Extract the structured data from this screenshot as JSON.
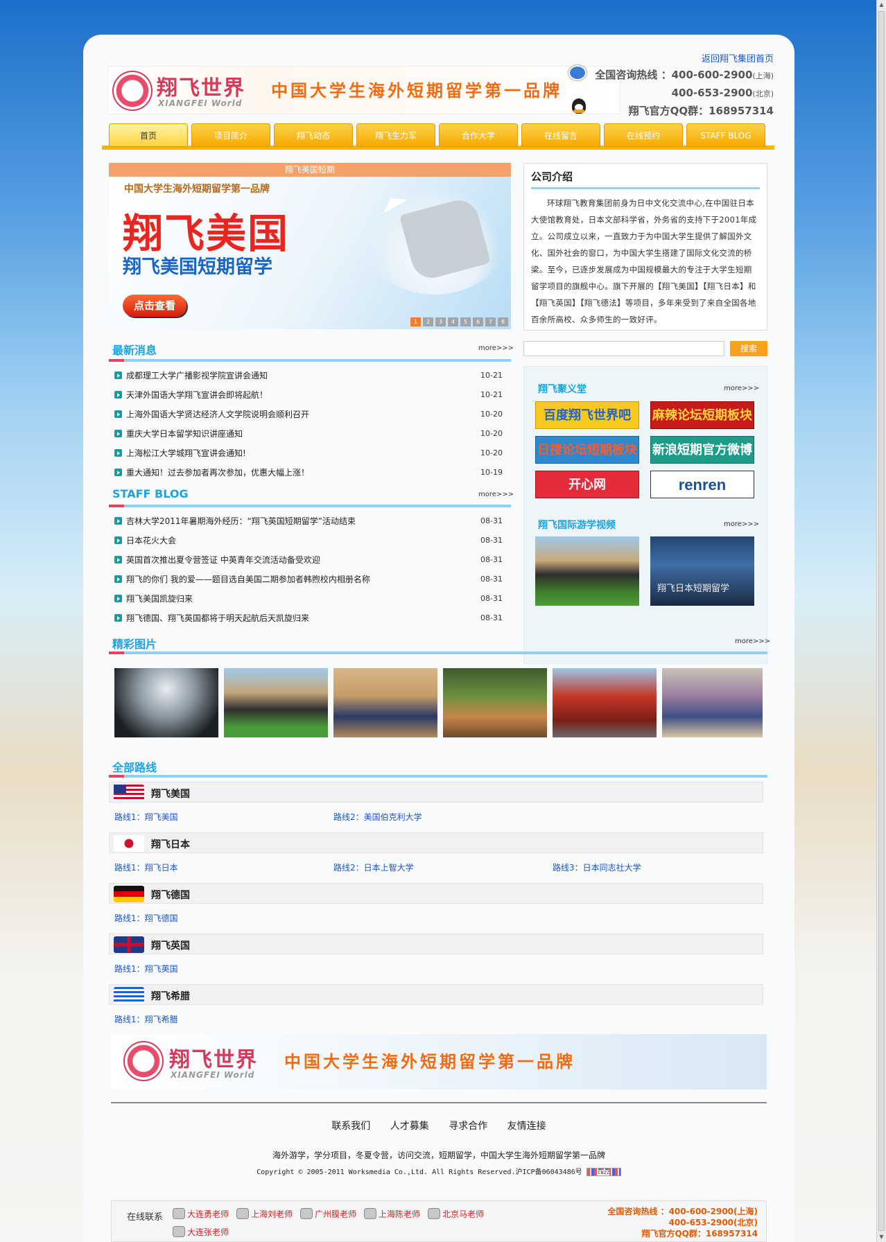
{
  "header": {
    "top_link": "返回翔飞集团首页",
    "logo_name": "翔飞世界",
    "logo_sub": "XIANGFEI World",
    "slogan": "中国大学生海外短期留学第一品牌",
    "hotline_label": "全国咨询热线 ：400-600-2900",
    "hotline1_city": "(上海)",
    "hotline2": "400-653-2900",
    "hotline2_city": "(北京)",
    "qq_group": "翔飞官方QQ群：168957314"
  },
  "nav": [
    "首页",
    "项目简介",
    "翔飞动态",
    "翔飞生力军",
    "合作大学",
    "在线留言",
    "在线预约",
    "STAFF BLOG"
  ],
  "banner": {
    "title": "翔飞美国短期",
    "tag": "中国大学生海外短期留学第一品牌",
    "big": "翔飞美国",
    "sub": "翔飞美国短期留学",
    "button": "点击查看",
    "pages": [
      "1",
      "2",
      "3",
      "4",
      "5",
      "6",
      "7",
      "8"
    ]
  },
  "intro": {
    "title": "公司介绍",
    "text": "环球翔飞教育集团前身为日中文化交流中心,在中国驻日本大使馆教育处，日本文部科学省，外务省的支持下于2001年成立。公司成立以来，一直致力于为中国大学生提供了解国外文化、国外社会的窗口，为中国大学生搭建了国际文化交流的桥梁。至今，已逐步发展成为中国规模最大的专注于大学生短期留学项目的旗舰中心。旗下开展的【翔飞美国】【翔飞日本】和【翔飞英国】【翔飞德法】等项目，多年来受到了来自全国各地百余所高校、众多师生的一致好评。"
  },
  "search": {
    "button": "搜索",
    "placeholder": ""
  },
  "more": "more>>>",
  "news": {
    "title": "最新消息",
    "items": [
      {
        "text": "成都理工大学广播影视学院宣讲会通知",
        "date": "10-21"
      },
      {
        "text": "天津外国语大学翔飞宣讲会即将起航！",
        "date": "10-21"
      },
      {
        "text": "上海外国语大学贤达经济人文学院说明会顺利召开",
        "date": "10-20"
      },
      {
        "text": "重庆大学日本留学知识讲座通知",
        "date": "10-20"
      },
      {
        "text": "上海松江大学城翔飞宣讲会通知!",
        "date": "10-20"
      },
      {
        "text": "重大通知！过去参加者再次参加，优惠大幅上涨！",
        "date": "10-19"
      }
    ]
  },
  "blog": {
    "title": "STAFF BLOG",
    "items": [
      {
        "text": "吉林大学2011年暑期海外经历：“翔飞英国短期留学”活动结束",
        "date": "08-31"
      },
      {
        "text": "日本花火大会",
        "date": "08-31"
      },
      {
        "text": "英国首次推出夏令营签证 中英青年交流活动备受欢迎",
        "date": "08-31"
      },
      {
        "text": "翔飞的你们 我的爱——题目选自美国二期参加者韩煦校内相册名称",
        "date": "08-31"
      },
      {
        "text": "翔飞美国凯旋归来",
        "date": "08-31"
      },
      {
        "text": "翔飞德国、翔飞英国都将于明天起航后天凯旋归来",
        "date": "08-31"
      }
    ]
  },
  "community": {
    "title": "翔飞聚义堂",
    "tiles": [
      "百度翔飞世界吧",
      "麻辣论坛短期板块",
      "日搜论坛短期板块",
      "新浪短期官方微博",
      "开心网",
      "renren"
    ]
  },
  "video": {
    "title": "翔飞国际游学视频",
    "caption2": "翔飞日本短期留学"
  },
  "photos": {
    "title": "精彩图片"
  },
  "routes": {
    "title": "全部路线",
    "groups": [
      {
        "name": "翔飞美国",
        "links": [
          "路线1：翔飞美国",
          "路线2：美国伯克利大学"
        ]
      },
      {
        "name": "翔飞日本",
        "links": [
          "路线1：翔飞日本",
          "路线2：日本上智大学",
          "路线3：日本同志社大学"
        ]
      },
      {
        "name": "翔飞德国",
        "links": [
          "路线1：翔飞德国"
        ]
      },
      {
        "name": "翔飞英国",
        "links": [
          "路线1：翔飞英国"
        ]
      },
      {
        "name": "翔飞希腊",
        "links": [
          "路线1：翔飞希腊"
        ]
      }
    ]
  },
  "footer": {
    "links": [
      "联系我们",
      "人才募集",
      "寻求合作",
      "友情连接"
    ],
    "desc": "海外游学，学分项目，冬夏令营，访问交流，短期留学，中国大学生海外短期留学第一品牌",
    "copyright": "Copyright © 2005-2011 Worksmedia Co.,Ltd. All Rights Reserved.沪ICP备06043486号",
    "cnzz": "CNZZ"
  },
  "online": {
    "label": "在线联系",
    "teachers": [
      "大连勇老师",
      "上海刘老师",
      "广州膜老师",
      "上海陈老师",
      "北京马老师",
      "大连张老师"
    ],
    "hotline": "全国咨询热线 ：400-600-2900(上海)",
    "hotline2": "400-653-2900(北京)",
    "qq": "翔飞官方QQ群：168957314"
  },
  "colors": {
    "accent": "#1aa4e2",
    "nav": "#f6a900",
    "red": "#e2445b",
    "link": "#1a56c9"
  }
}
